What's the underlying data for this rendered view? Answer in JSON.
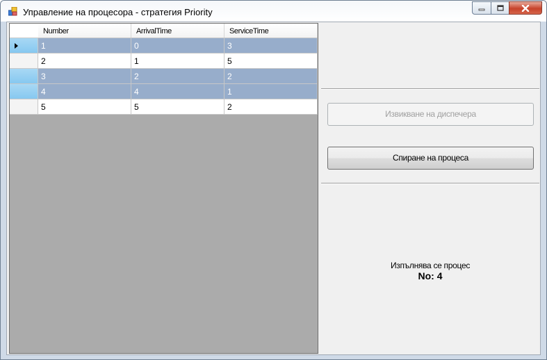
{
  "window": {
    "title": "Управление на процесора - стратегия Priority"
  },
  "grid": {
    "columns": [
      "Number",
      "ArrivalTime",
      "ServiceTime"
    ],
    "rows": [
      {
        "values": [
          "1",
          "0",
          "3"
        ],
        "selected": true,
        "current": true
      },
      {
        "values": [
          "2",
          "1",
          "5"
        ],
        "selected": false,
        "current": false
      },
      {
        "values": [
          "3",
          "2",
          "2"
        ],
        "selected": true,
        "current": false
      },
      {
        "values": [
          "4",
          "4",
          "1"
        ],
        "selected": true,
        "current": false
      },
      {
        "values": [
          "5",
          "5",
          "2"
        ],
        "selected": false,
        "current": false
      }
    ]
  },
  "actions": {
    "dispatcher_button": "Извикване на диспечера",
    "stop_button": "Спиране на процеса"
  },
  "status": {
    "label": "Изпълнява се процес",
    "value": "No: 4"
  },
  "icons": {
    "app": "windows-form-icon",
    "minimize": "minimize-icon",
    "maximize": "maximize-icon",
    "close": "close-icon",
    "row_pointer": "row-pointer-icon"
  }
}
